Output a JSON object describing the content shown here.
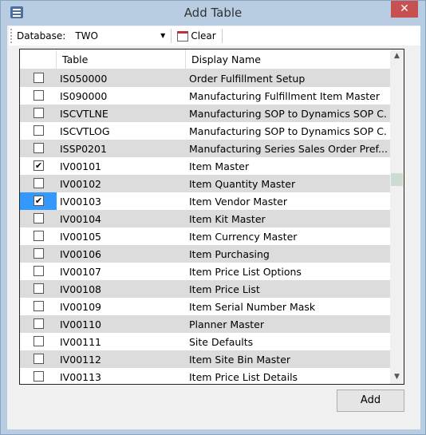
{
  "window": {
    "title": "Add Table",
    "close_label": "✕"
  },
  "toolbar": {
    "database_label": "Database:",
    "database_value": "TWO",
    "clear_label": "Clear"
  },
  "grid": {
    "columns": [
      "Table",
      "Display Name"
    ],
    "rows": [
      {
        "checked": false,
        "table": "IS050000",
        "name": "Order Fulfillment Setup"
      },
      {
        "checked": false,
        "table": "IS090000",
        "name": "Manufacturing Fulfillment Item Master"
      },
      {
        "checked": false,
        "table": "ISCVTLNE",
        "name": "Manufacturing SOP to Dynamics SOP C..."
      },
      {
        "checked": false,
        "table": "ISCVTLOG",
        "name": "Manufacturing SOP to Dynamics SOP C..."
      },
      {
        "checked": false,
        "table": "ISSP0201",
        "name": "Manufacturing Series Sales Order Pref..."
      },
      {
        "checked": true,
        "table": "IV00101",
        "name": "Item Master"
      },
      {
        "checked": false,
        "table": "IV00102",
        "name": "Item Quantity Master"
      },
      {
        "checked": true,
        "table": "IV00103",
        "name": "Item Vendor Master",
        "selected": true
      },
      {
        "checked": false,
        "table": "IV00104",
        "name": "Item Kit Master"
      },
      {
        "checked": false,
        "table": "IV00105",
        "name": "Item Currency Master"
      },
      {
        "checked": false,
        "table": "IV00106",
        "name": "Item Purchasing"
      },
      {
        "checked": false,
        "table": "IV00107",
        "name": "Item Price List Options"
      },
      {
        "checked": false,
        "table": "IV00108",
        "name": "Item Price List"
      },
      {
        "checked": false,
        "table": "IV00109",
        "name": "Item Serial Number Mask"
      },
      {
        "checked": false,
        "table": "IV00110",
        "name": "Planner Master"
      },
      {
        "checked": false,
        "table": "IV00111",
        "name": "Site Defaults"
      },
      {
        "checked": false,
        "table": "IV00112",
        "name": "Item Site Bin Master"
      },
      {
        "checked": false,
        "table": "IV00113",
        "name": "Item Price List Details"
      }
    ]
  },
  "footer": {
    "add_label": "Add"
  }
}
